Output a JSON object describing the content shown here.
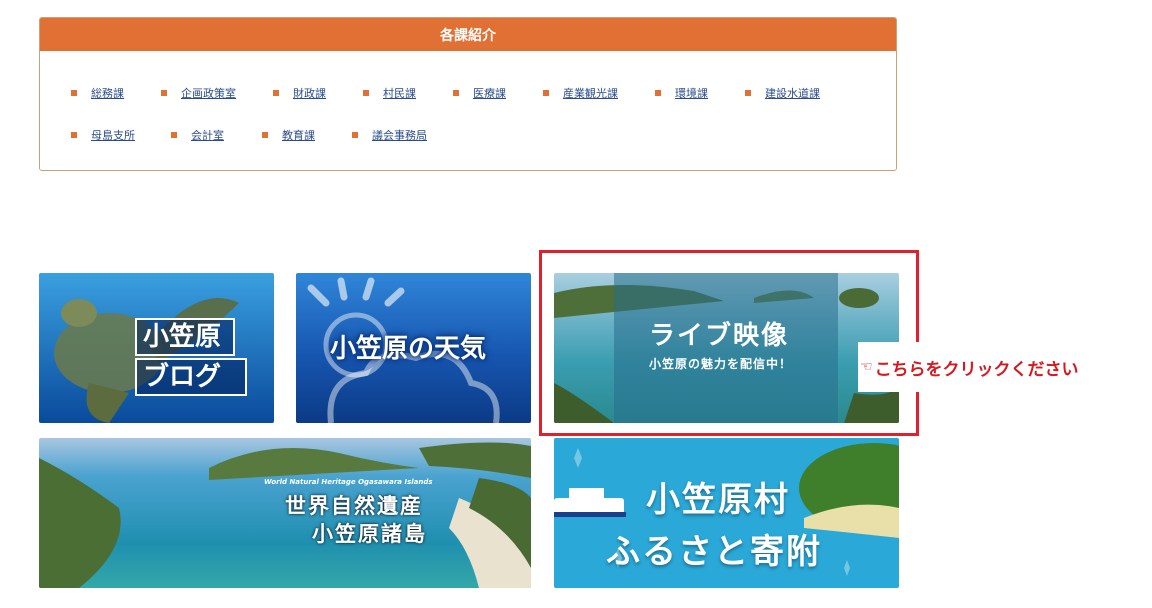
{
  "dept_section": {
    "title": "各課紹介",
    "items": [
      {
        "label": "総務課"
      },
      {
        "label": "企画政策室"
      },
      {
        "label": "財政課"
      },
      {
        "label": "村民課"
      },
      {
        "label": "医療課"
      },
      {
        "label": "産業観光課"
      },
      {
        "label": "環境課"
      },
      {
        "label": "建設水道課"
      },
      {
        "label": "母島支所"
      },
      {
        "label": "会計室"
      },
      {
        "label": "教育課"
      },
      {
        "label": "議会事務局"
      }
    ]
  },
  "banners": {
    "blog": {
      "line1": "小笠原",
      "line2": "ブログ"
    },
    "weather": {
      "title": "小笠原の天気"
    },
    "live": {
      "title": "ライブ映像",
      "subtitle": "小笠原の魅力を配信中！"
    },
    "heritage": {
      "en": "World Natural Heritage Ogasawara Islands",
      "line1": "世界自然遺産",
      "line2": "小笠原諸島"
    },
    "furusato": {
      "line1": "小笠原村",
      "line2": "ふるさと寄附"
    }
  },
  "callout": {
    "text": "こちらをクリックください",
    "icon": "pointing-hand-icon",
    "color": "#d6181f"
  },
  "colors": {
    "accent": "#e07034",
    "link": "#2b4c8a",
    "highlight": "#e0202a"
  }
}
